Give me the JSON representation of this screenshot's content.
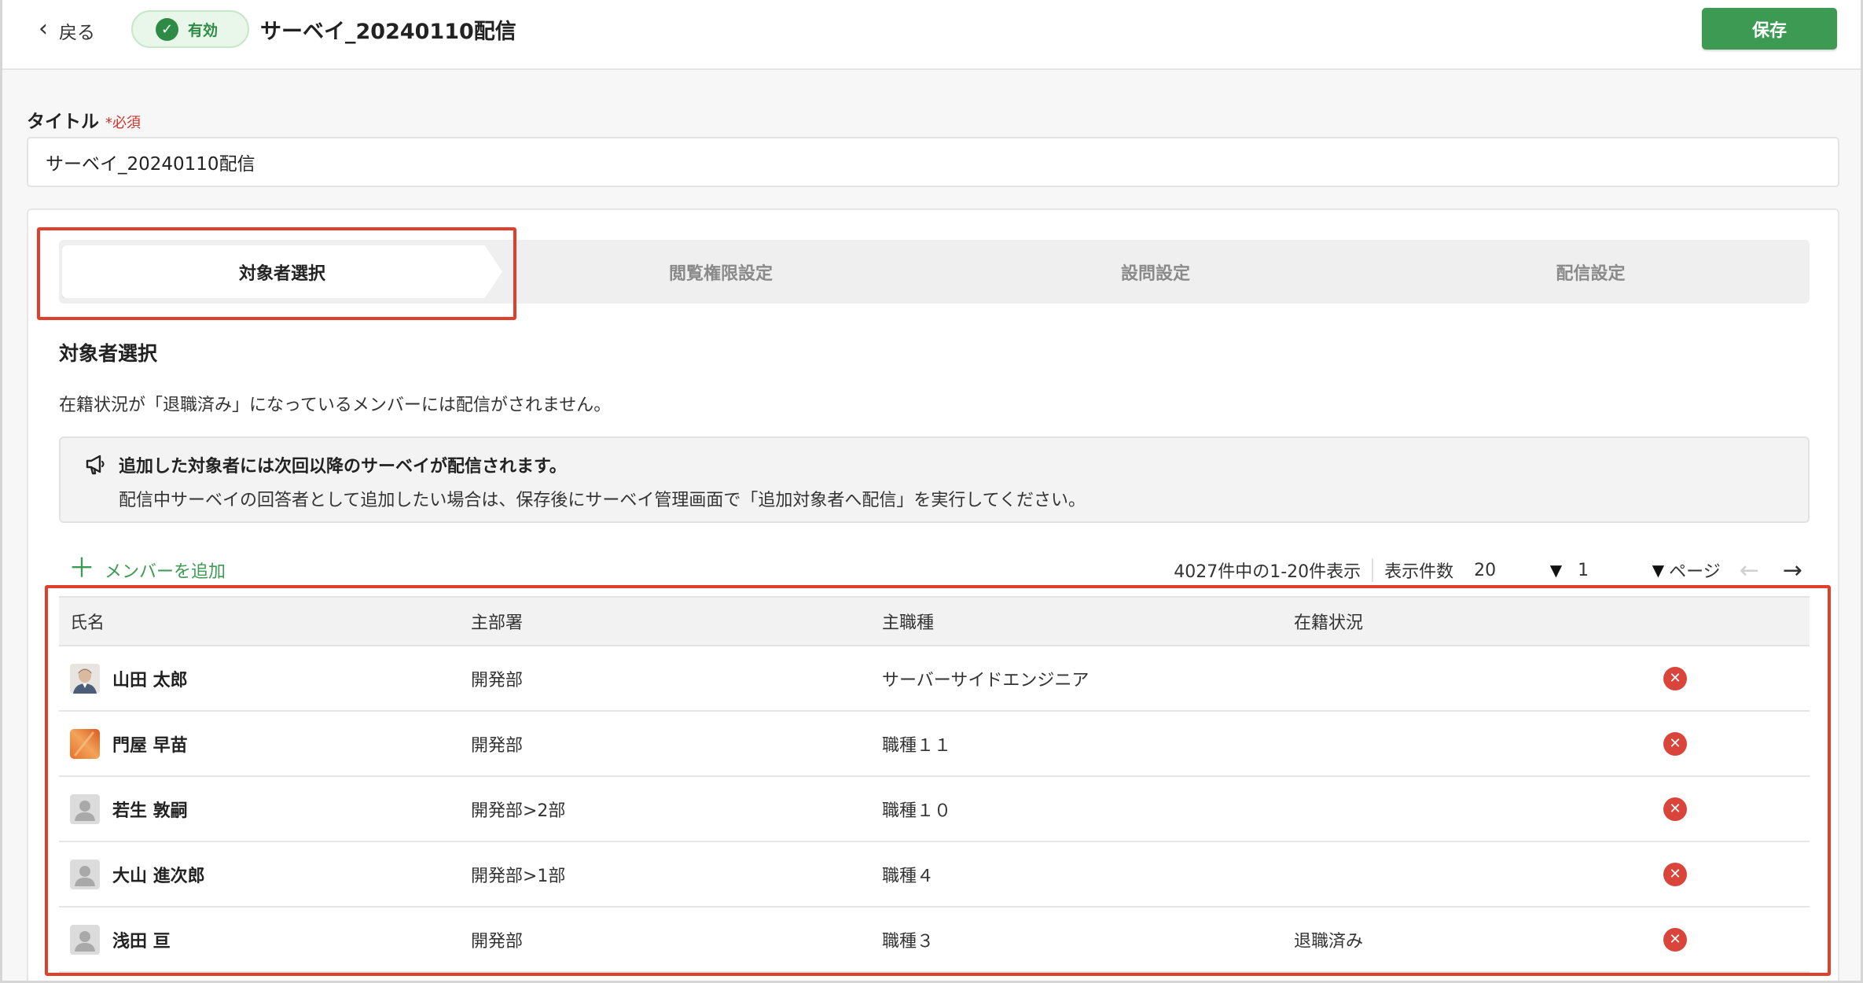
{
  "header": {
    "back_label": "戻る",
    "status_label": "有効",
    "title": "サーベイ_20240110配信",
    "save_label": "保存"
  },
  "title_field": {
    "label": "タイトル",
    "required": "*必須",
    "value": "サーベイ_20240110配信"
  },
  "steps": [
    {
      "label": "対象者選択",
      "active": true
    },
    {
      "label": "閲覧権限設定",
      "active": false
    },
    {
      "label": "設問設定",
      "active": false
    },
    {
      "label": "配信設定",
      "active": false
    }
  ],
  "section": {
    "title": "対象者選択",
    "description": "在籍状況が「退職済み」になっているメンバーには配信がされません。"
  },
  "notice": {
    "icon": "megaphone-icon",
    "title": "追加した対象者には次回以降のサーベイが配信されます。",
    "body": "配信中サーベイの回答者として追加したい場合は、保存後にサーベイ管理画面で「追加対象者へ配信」を実行してください。"
  },
  "toolbar": {
    "add_member_label": "メンバーを追加",
    "range_text": "4027件中の1-20件表示",
    "page_size_label": "表示件数",
    "page_size_value": "20",
    "page_value": "1",
    "page_label": "ページ"
  },
  "table": {
    "columns": [
      "氏名",
      "主部署",
      "主職種",
      "在籍状況"
    ],
    "rows": [
      {
        "name": "山田 太郎",
        "dept": "開発部",
        "job": "サーバーサイドエンジニア",
        "status": "",
        "avatar": "photo"
      },
      {
        "name": "門屋 早苗",
        "dept": "開発部",
        "job": "職種１１",
        "status": "",
        "avatar": "orange"
      },
      {
        "name": "若生 敦嗣",
        "dept": "開発部>2部",
        "job": "職種１０",
        "status": "",
        "avatar": "default"
      },
      {
        "name": "大山 進次郎",
        "dept": "開発部>1部",
        "job": "職種４",
        "status": "",
        "avatar": "default"
      },
      {
        "name": "浅田 亘",
        "dept": "開発部",
        "job": "職種３",
        "status": "退職済み",
        "avatar": "default"
      }
    ]
  },
  "colors": {
    "accent_green": "#3c9a52",
    "highlight_red": "#e0402a",
    "remove_red": "#d9453a"
  }
}
